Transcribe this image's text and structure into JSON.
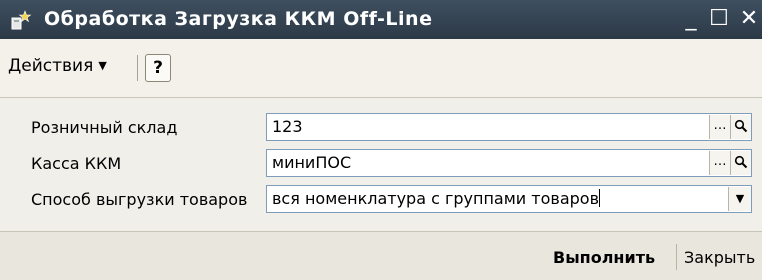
{
  "window": {
    "title": "Обработка  Загрузка ККМ Off-Line",
    "min_glyph": "_",
    "max_glyph": "☐",
    "close_glyph": "✕"
  },
  "toolbar": {
    "actions_label": "Действия",
    "help_label": "?"
  },
  "form": {
    "retail_store": {
      "label": "Розничный склад",
      "value": "123"
    },
    "kkm": {
      "label": "Касса ККМ",
      "value": "миниПОС"
    },
    "export_mode": {
      "label": "Способ выгрузки товаров",
      "value": "вся номенклатура с группами товаров"
    }
  },
  "footer": {
    "execute_label": "Выполнить",
    "close_label": "Закрыть"
  },
  "icons": {
    "select": "…",
    "search": "🔍",
    "dropdown": "▼",
    "caret": "▼"
  },
  "colors": {
    "titlebar": "#34414f",
    "field_border": "#7f9db9"
  }
}
